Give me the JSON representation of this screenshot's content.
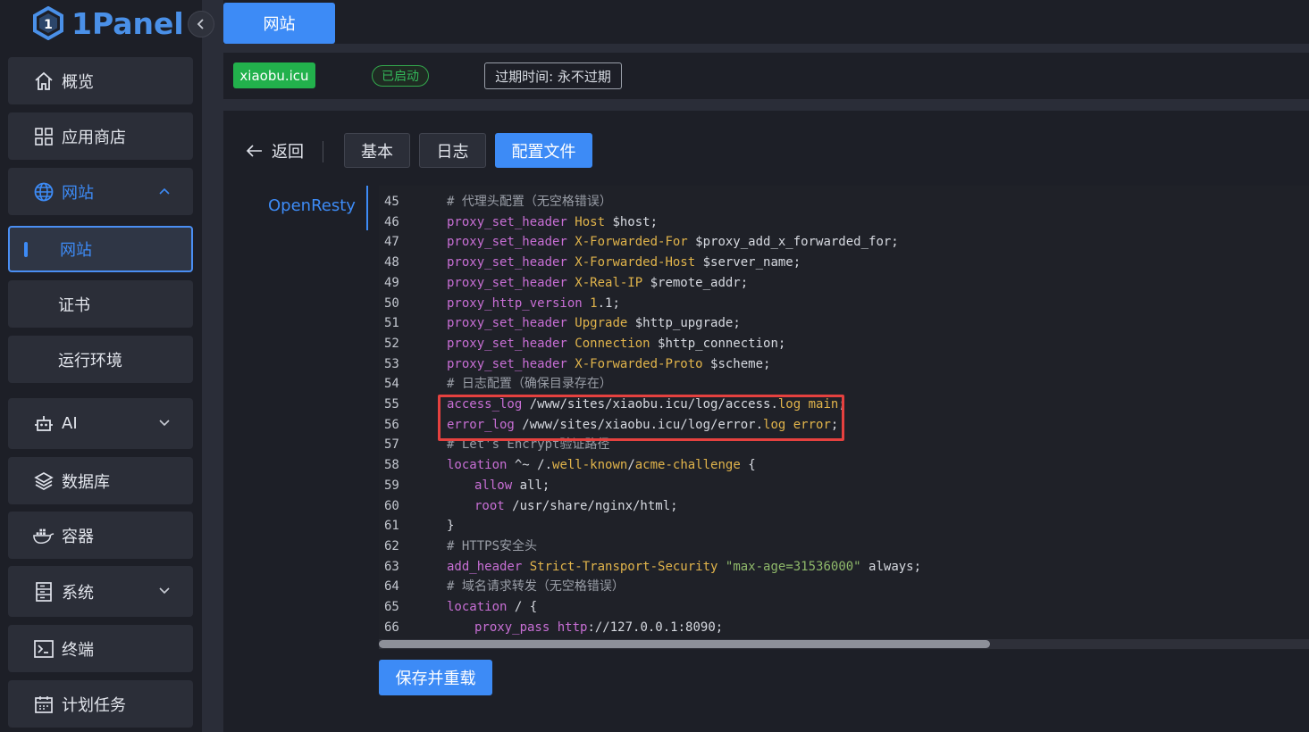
{
  "app": {
    "logo_text": "1Panel",
    "accent": "#3d8bf6"
  },
  "sidebar": {
    "items": [
      {
        "label": "概览",
        "icon": "home-icon"
      },
      {
        "label": "应用商店",
        "icon": "grid-icon"
      },
      {
        "label": "网站",
        "icon": "globe-icon",
        "expanded": true
      },
      {
        "label": "网站",
        "sub": true,
        "active": true
      },
      {
        "label": "证书",
        "sub": true
      },
      {
        "label": "运行环境",
        "sub": true
      },
      {
        "label": "AI",
        "icon": "robot-icon"
      },
      {
        "label": "数据库",
        "icon": "layers-icon"
      },
      {
        "label": "容器",
        "icon": "docker-icon"
      },
      {
        "label": "系统",
        "icon": "server-icon"
      },
      {
        "label": "终端",
        "icon": "terminal-icon"
      },
      {
        "label": "计划任务",
        "icon": "calendar-icon"
      }
    ]
  },
  "topbar": {
    "tab_label": "网站"
  },
  "site": {
    "domain": "xiaobu.icu",
    "status": "已启动",
    "expire": "过期时间: 永不过期",
    "status_color": "#33b85a",
    "domain_color": "#22b14c"
  },
  "panel": {
    "back_label": "返回",
    "tabs": [
      {
        "label": "基本"
      },
      {
        "label": "日志"
      },
      {
        "label": "配置文件",
        "active": true
      }
    ],
    "side_label": "OpenResty",
    "save_label": "保存并重载"
  },
  "editor": {
    "lines": [
      {
        "n": "45",
        "parts": [
          [
            "c-cmt",
            "# 代理头配置（无空格错误）"
          ]
        ]
      },
      {
        "n": "46",
        "parts": [
          [
            "c-kw",
            "proxy_set_header"
          ],
          [
            "c-txt",
            " "
          ],
          [
            "c-arg",
            "Host"
          ],
          [
            "c-txt",
            " $host;"
          ]
        ]
      },
      {
        "n": "47",
        "parts": [
          [
            "c-kw",
            "proxy_set_header"
          ],
          [
            "c-txt",
            " "
          ],
          [
            "c-arg",
            "X-Forwarded-For"
          ],
          [
            "c-txt",
            " $proxy_add_x_forwarded_for;"
          ]
        ]
      },
      {
        "n": "48",
        "parts": [
          [
            "c-kw",
            "proxy_set_header"
          ],
          [
            "c-txt",
            " "
          ],
          [
            "c-arg",
            "X-Forwarded-Host"
          ],
          [
            "c-txt",
            " $server_name;"
          ]
        ]
      },
      {
        "n": "49",
        "parts": [
          [
            "c-kw",
            "proxy_set_header"
          ],
          [
            "c-txt",
            " "
          ],
          [
            "c-arg",
            "X-Real-IP"
          ],
          [
            "c-txt",
            " $remote_addr;"
          ]
        ]
      },
      {
        "n": "50",
        "parts": [
          [
            "c-kw",
            "proxy_http_version"
          ],
          [
            "c-txt",
            " "
          ],
          [
            "c-num",
            "1"
          ],
          [
            "c-txt",
            ".1;"
          ]
        ]
      },
      {
        "n": "51",
        "parts": [
          [
            "c-kw",
            "proxy_set_header"
          ],
          [
            "c-txt",
            " "
          ],
          [
            "c-arg",
            "Upgrade"
          ],
          [
            "c-txt",
            " $http_upgrade;"
          ]
        ]
      },
      {
        "n": "52",
        "parts": [
          [
            "c-kw",
            "proxy_set_header"
          ],
          [
            "c-txt",
            " "
          ],
          [
            "c-arg",
            "Connection"
          ],
          [
            "c-txt",
            " $http_connection;"
          ]
        ]
      },
      {
        "n": "53",
        "parts": [
          [
            "c-kw",
            "proxy_set_header"
          ],
          [
            "c-txt",
            " "
          ],
          [
            "c-arg",
            "X-Forwarded-Proto"
          ],
          [
            "c-txt",
            " $scheme;"
          ]
        ]
      },
      {
        "n": "54",
        "parts": [
          [
            "c-cmt",
            "# 日志配置（确保目录存在）"
          ]
        ]
      },
      {
        "n": "55",
        "parts": [
          [
            "c-kw",
            "access_log"
          ],
          [
            "c-txt",
            " /www/sites/xiaobu.icu/log/access."
          ],
          [
            "c-arg",
            "log"
          ],
          [
            "c-txt",
            " "
          ],
          [
            "c-arg",
            "main"
          ],
          [
            "c-txt",
            ";"
          ]
        ]
      },
      {
        "n": "56",
        "parts": [
          [
            "c-kw",
            "error_log"
          ],
          [
            "c-txt",
            " /www/sites/xiaobu.icu/log/error."
          ],
          [
            "c-arg",
            "log"
          ],
          [
            "c-txt",
            " "
          ],
          [
            "c-arg",
            "error"
          ],
          [
            "c-txt",
            ";"
          ]
        ]
      },
      {
        "n": "57",
        "parts": [
          [
            "c-cmt",
            "# Let's Encrypt验证路径"
          ]
        ]
      },
      {
        "n": "58",
        "parts": [
          [
            "c-kw",
            "location"
          ],
          [
            "c-txt",
            " ^~ /."
          ],
          [
            "c-arg",
            "well-known"
          ],
          [
            "c-txt",
            "/"
          ],
          [
            "c-arg",
            "acme-challenge"
          ],
          [
            "c-txt",
            " {"
          ]
        ]
      },
      {
        "n": "59",
        "indent": 2,
        "parts": [
          [
            "c-kw",
            "allow"
          ],
          [
            "c-txt",
            " all;"
          ]
        ]
      },
      {
        "n": "60",
        "indent": 2,
        "parts": [
          [
            "c-kw",
            "root"
          ],
          [
            "c-txt",
            " /usr/share/nginx/html;"
          ]
        ]
      },
      {
        "n": "61",
        "parts": [
          [
            "c-txt",
            "}"
          ]
        ]
      },
      {
        "n": "62",
        "parts": [
          [
            "c-cmt",
            "# HTTPS安全头"
          ]
        ]
      },
      {
        "n": "63",
        "parts": [
          [
            "c-kw",
            "add_header"
          ],
          [
            "c-txt",
            " "
          ],
          [
            "c-arg",
            "Strict-Transport-Security"
          ],
          [
            "c-txt",
            " "
          ],
          [
            "c-str",
            "\"max-age=31536000\""
          ],
          [
            "c-txt",
            " always;"
          ]
        ]
      },
      {
        "n": "64",
        "parts": [
          [
            "c-cmt",
            "# 域名请求转发（无空格错误）"
          ]
        ]
      },
      {
        "n": "65",
        "parts": [
          [
            "c-kw",
            "location"
          ],
          [
            "c-txt",
            " / {"
          ]
        ]
      },
      {
        "n": "66",
        "indent": 2,
        "parts": [
          [
            "c-kw",
            "proxy_pass"
          ],
          [
            "c-txt",
            " "
          ],
          [
            "c-kw",
            "http"
          ],
          [
            "c-txt",
            "://127.0.0.1:8090;"
          ]
        ]
      }
    ]
  }
}
